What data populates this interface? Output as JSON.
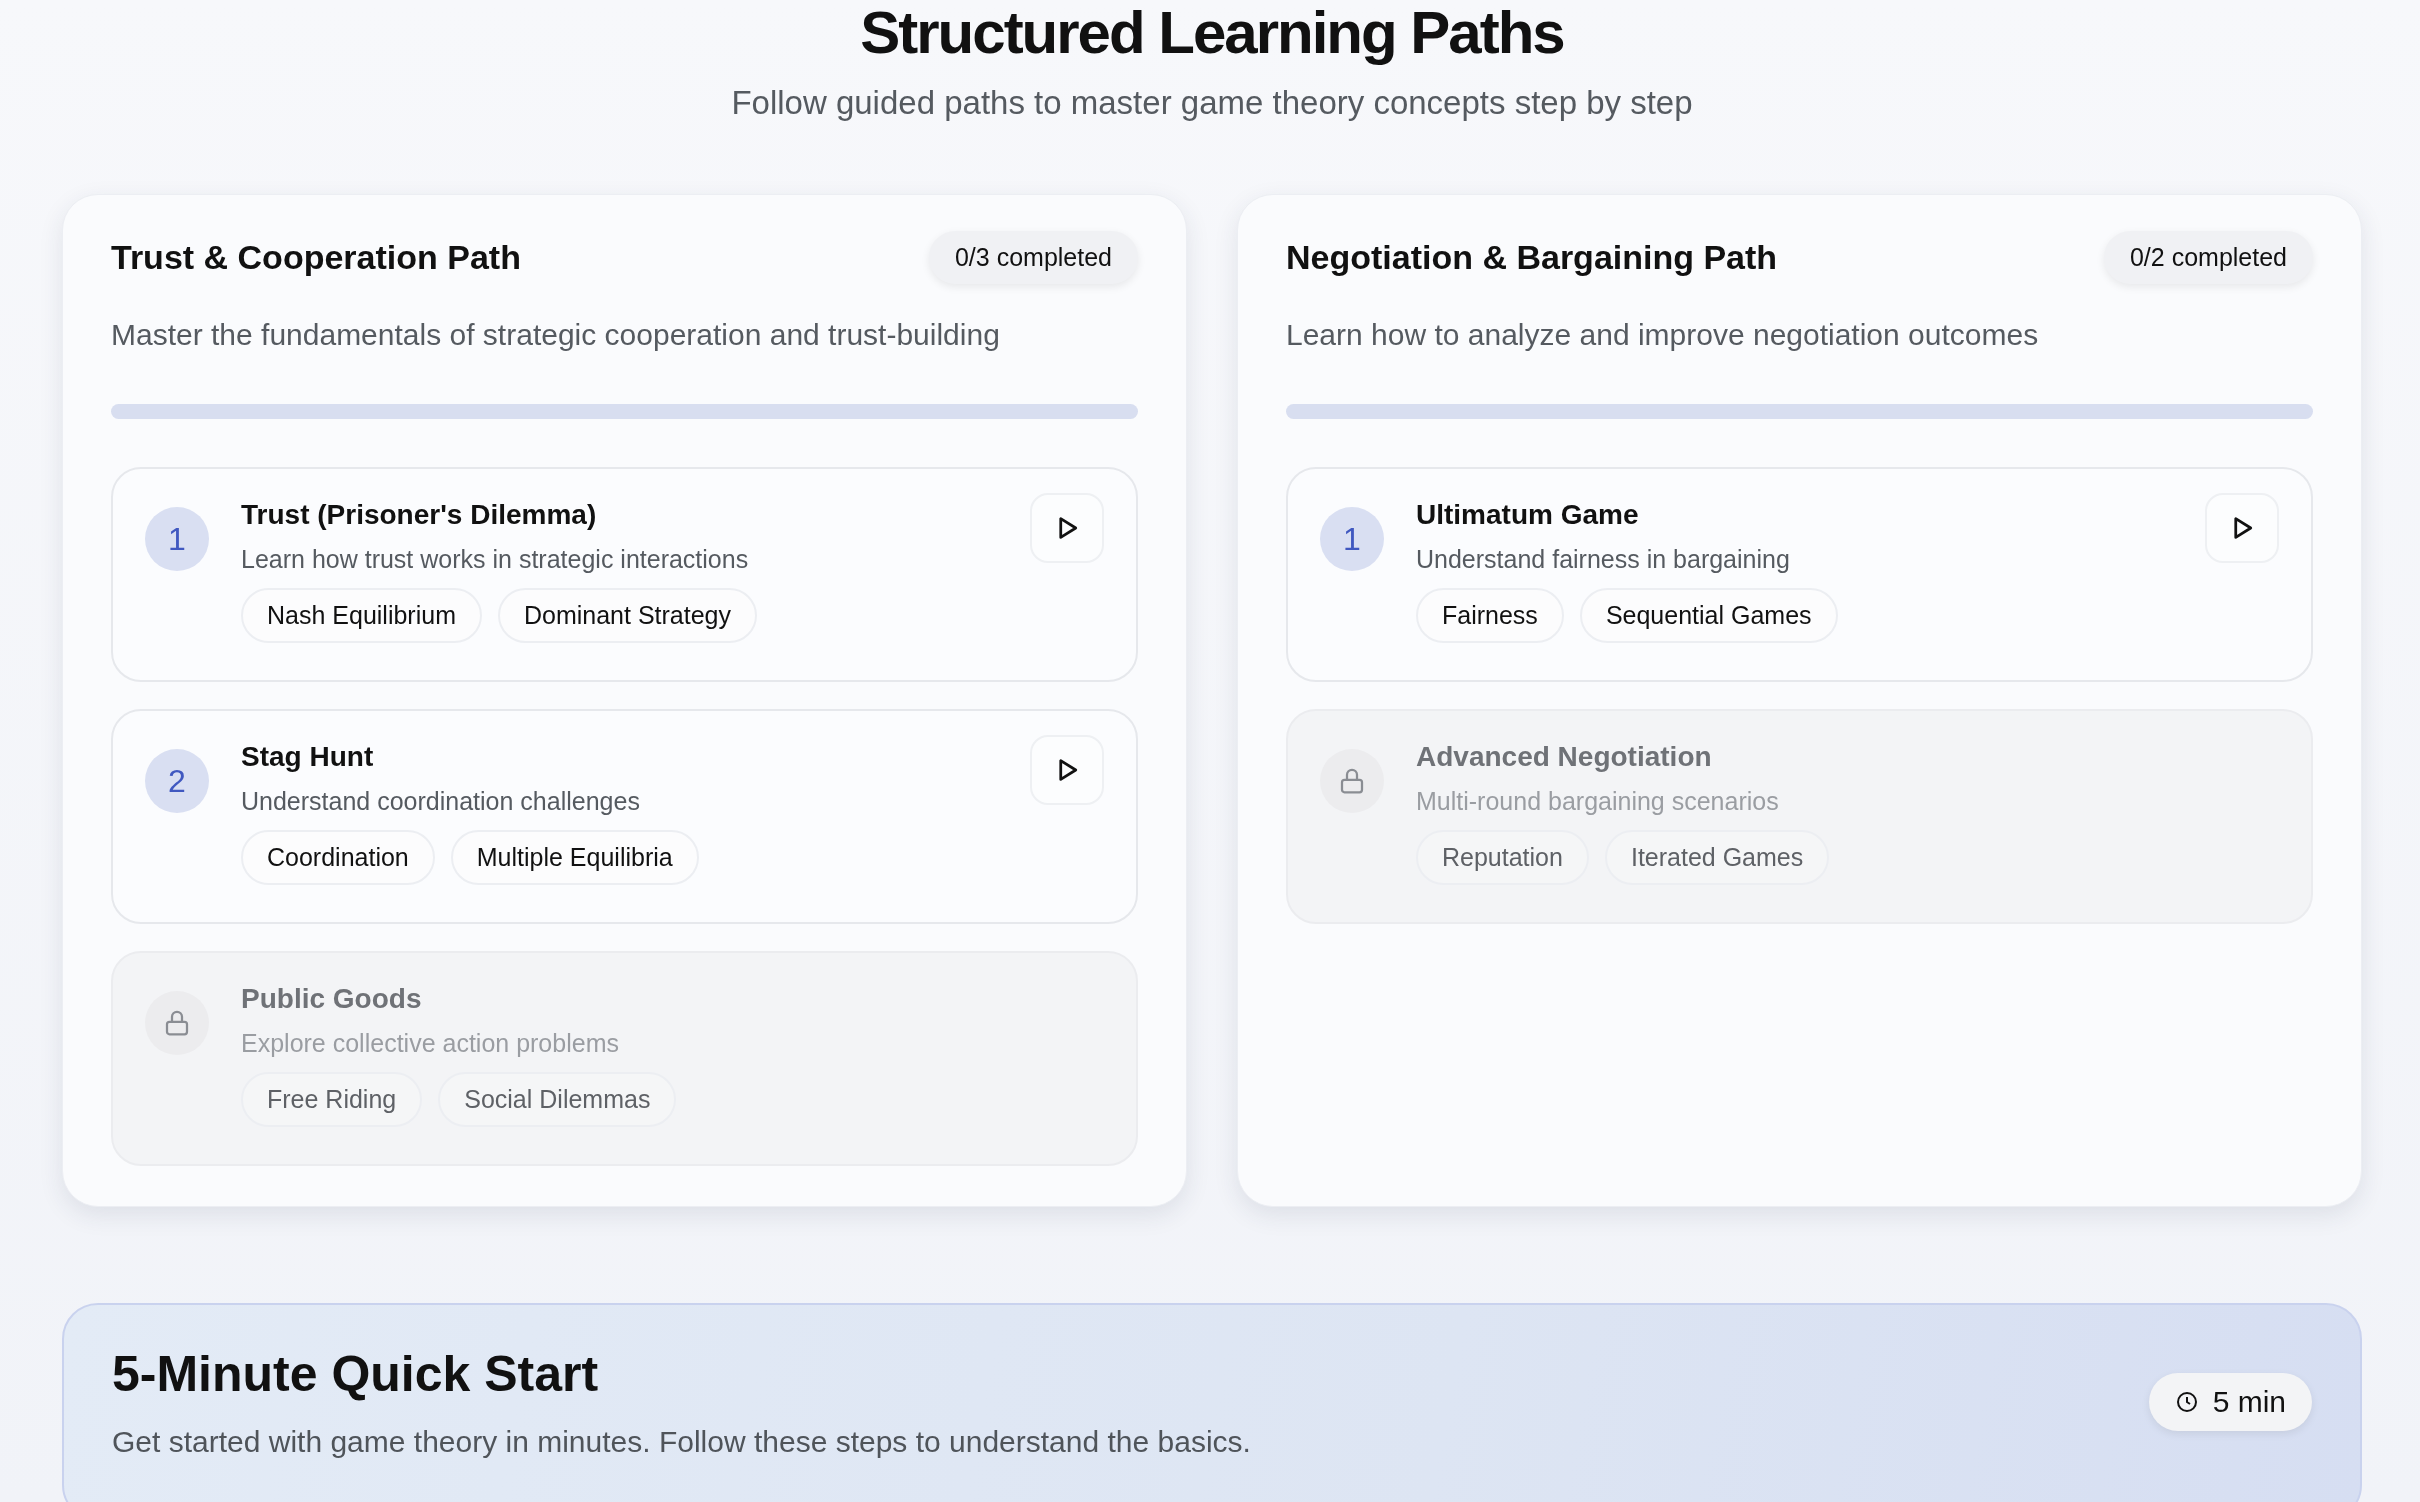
{
  "header": {
    "title": "Structured Learning Paths",
    "subtitle": "Follow guided paths to master game theory concepts step by step"
  },
  "paths": [
    {
      "title": "Trust & Cooperation Path",
      "badge": "0/3 completed",
      "description": "Master the fundamentals of strategic cooperation and trust-building",
      "level": 0,
      "steps": [
        {
          "number": "1",
          "locked": false,
          "title": "Trust (Prisoner's Dilemma)",
          "description": "Learn how trust works in strategic interactions",
          "tags": [
            "Nash Equilibrium",
            "Dominant Strategy"
          ]
        },
        {
          "number": "2",
          "locked": false,
          "title": "Stag Hunt",
          "description": "Understand coordination challenges",
          "tags": [
            "Coordination",
            "Multiple Equilibria"
          ]
        },
        {
          "locked": true,
          "title": "Public Goods",
          "description": "Explore collective action problems",
          "tags": [
            "Free Riding",
            "Social Dilemmas"
          ]
        }
      ]
    },
    {
      "title": "Negotiation & Bargaining Path",
      "badge": "0/2 completed",
      "description": "Learn how to analyze and improve negotiation outcomes",
      "level": 0,
      "steps": [
        {
          "number": "1",
          "locked": false,
          "title": "Ultimatum Game",
          "description": "Understand fairness in bargaining",
          "tags": [
            "Fairness",
            "Sequential Games"
          ]
        },
        {
          "locked": true,
          "title": "Advanced Negotiation",
          "description": "Multi-round bargaining scenarios",
          "tags": [
            "Reputation",
            "Iterated Games"
          ]
        }
      ]
    }
  ],
  "quick_start": {
    "title": "5-Minute Quick Start",
    "description": "Get started with game theory in minutes. Follow these steps to understand the basics.",
    "duration": "5 min"
  }
}
